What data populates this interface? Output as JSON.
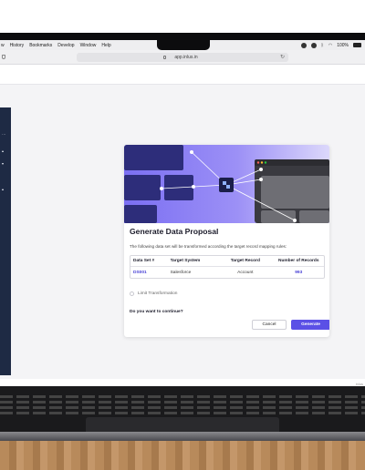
{
  "menubar": {
    "items": [
      "w",
      "History",
      "Bookmarks",
      "Develop",
      "Window",
      "Help"
    ],
    "battery": "100%"
  },
  "browser": {
    "url": "app.inlus.in"
  },
  "watermark": "inlus",
  "modal": {
    "title": "Generate Data Proposal",
    "description": "The following data set will be transformed according the target record mapping rules:",
    "table": {
      "headers": [
        "Data Set #",
        "Target System",
        "Target Record",
        "Number of Records"
      ],
      "rows": [
        {
          "dataset": "DS001",
          "system": "Salesforce",
          "record": "Account",
          "count": "993"
        }
      ]
    },
    "limit_label": "Limit Transformation",
    "question": "Do you want to continue?",
    "cancel_label": "Cancel",
    "generate_label": "Generate"
  },
  "colors": {
    "accent": "#5b50e6",
    "sidebar": "#1e2a44",
    "hero_start": "#7b6ff2"
  }
}
